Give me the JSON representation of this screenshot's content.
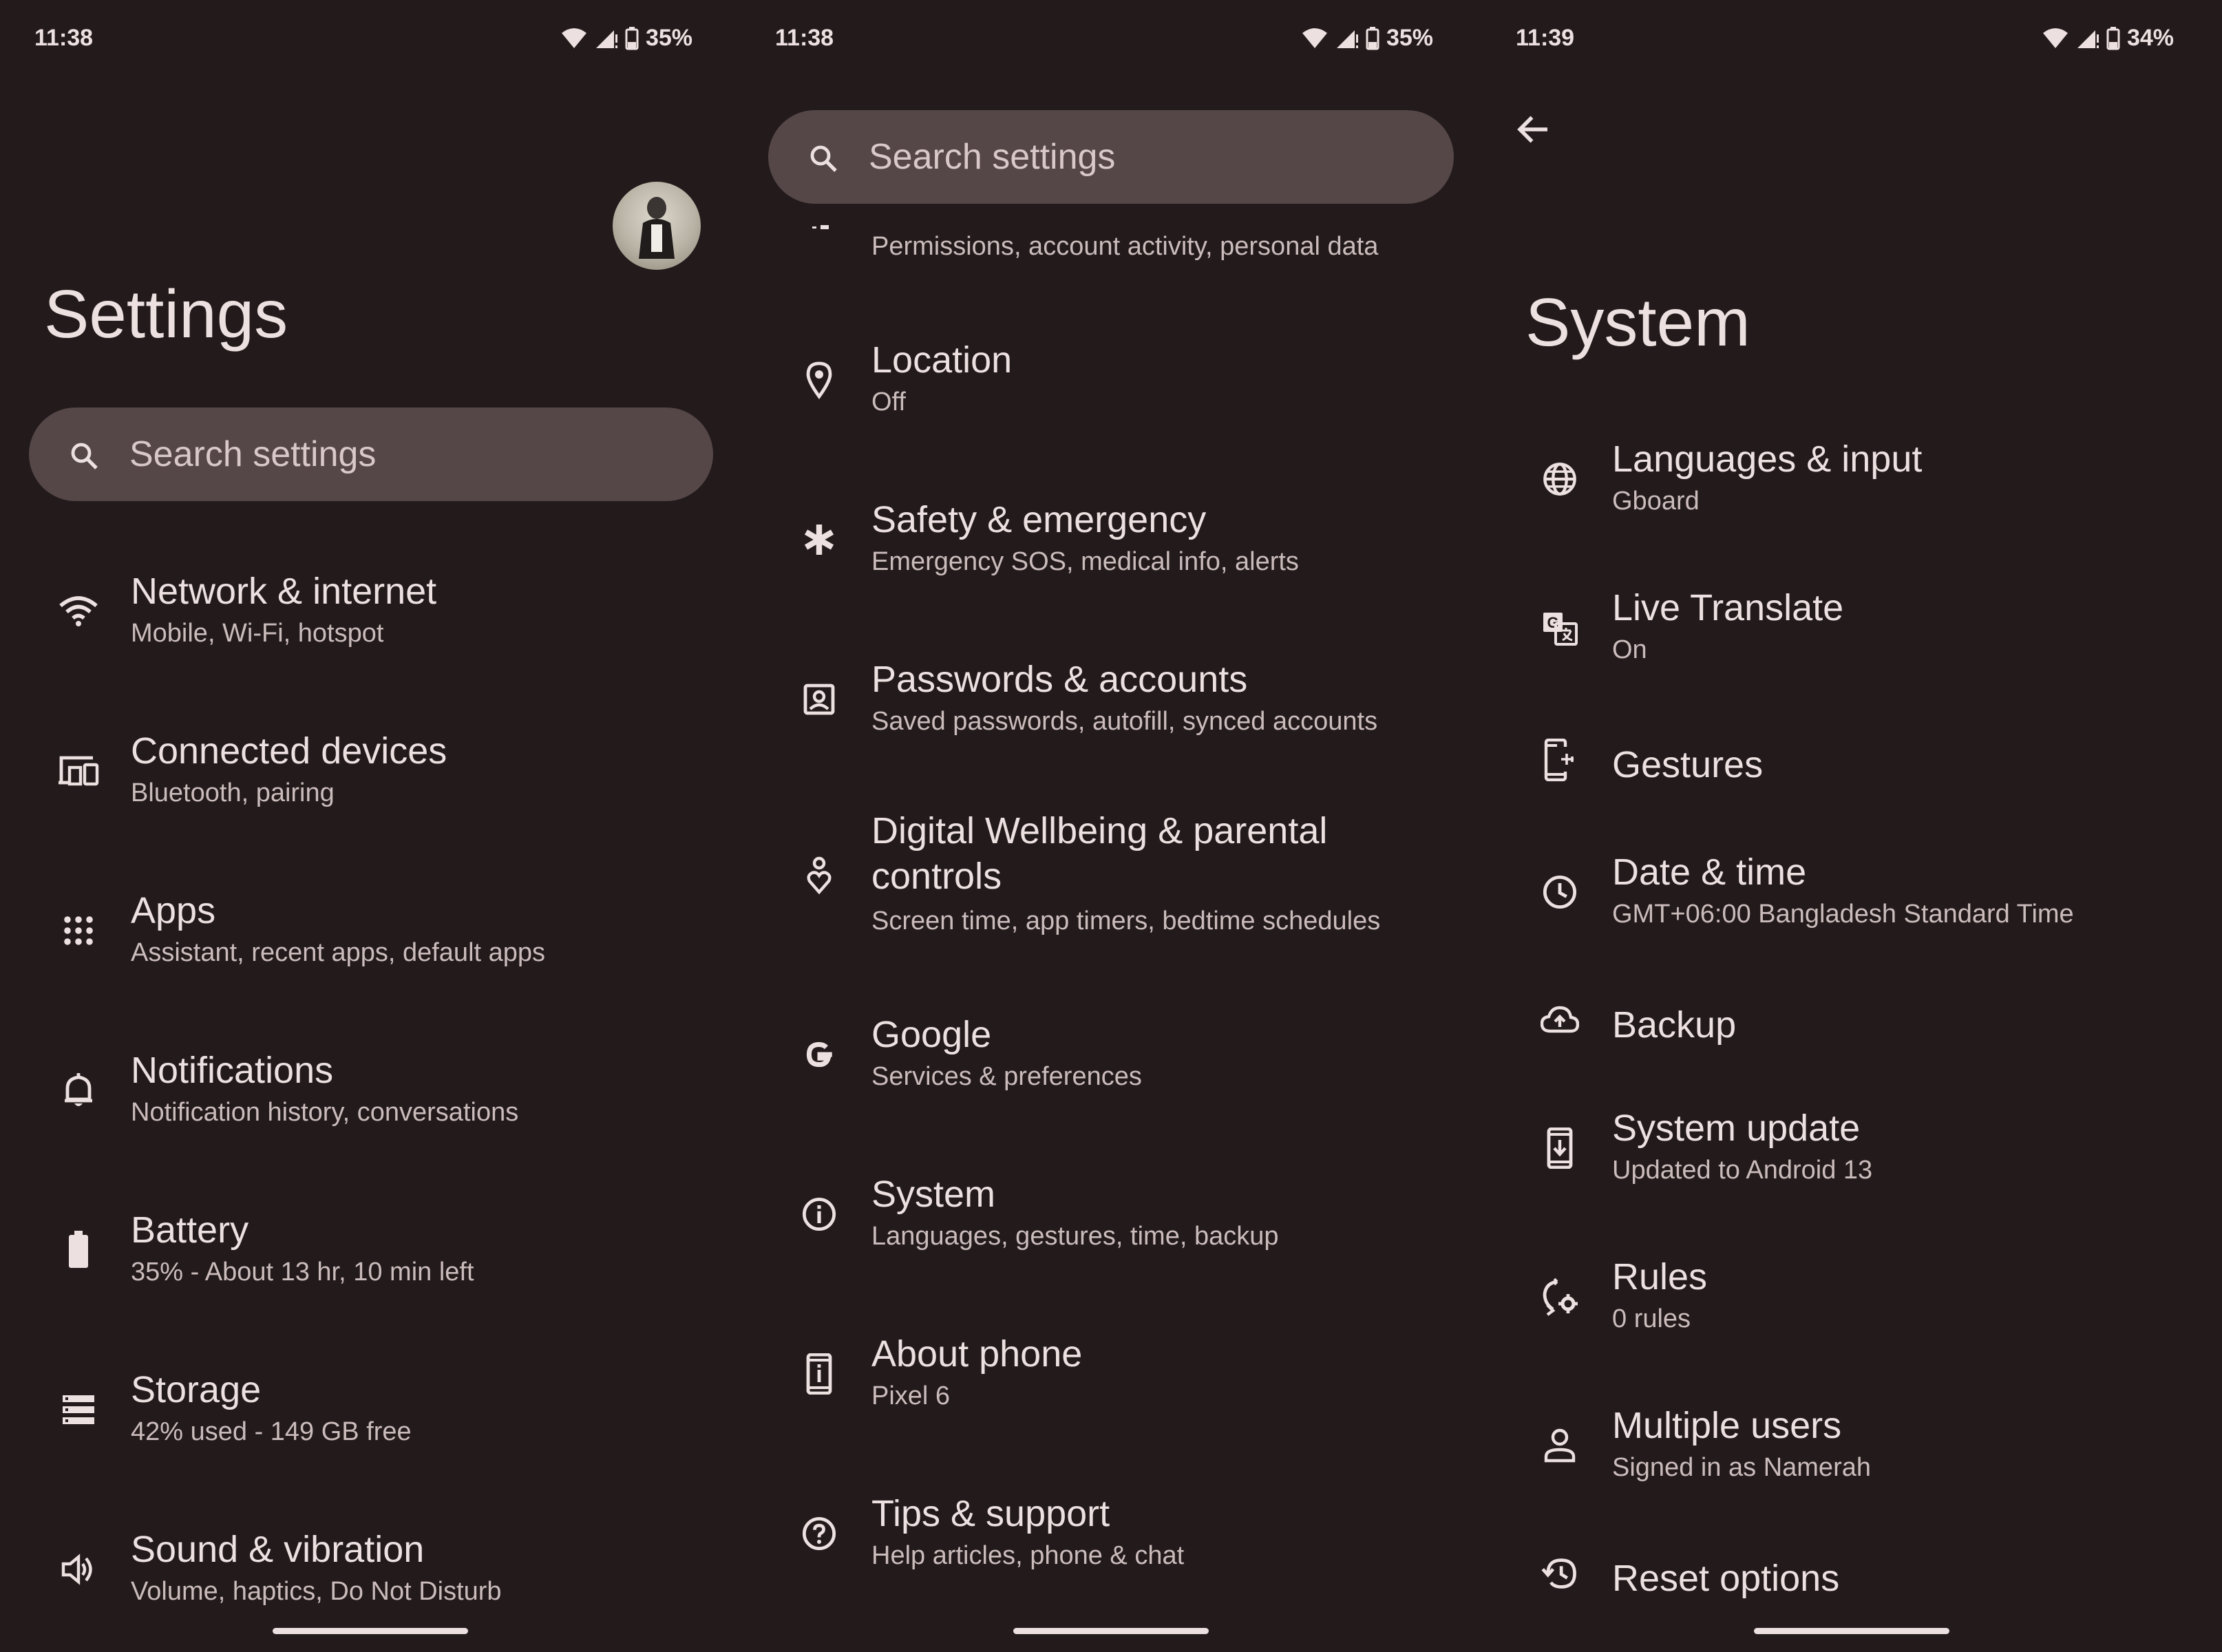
{
  "panel1": {
    "time": "11:38",
    "battery": "35%",
    "title": "Settings",
    "search_placeholder": "Search settings",
    "items": [
      {
        "title": "Network & internet",
        "subtitle": "Mobile, Wi-Fi, hotspot",
        "icon": "wifi-icon"
      },
      {
        "title": "Connected devices",
        "subtitle": "Bluetooth, pairing",
        "icon": "devices-icon"
      },
      {
        "title": "Apps",
        "subtitle": "Assistant, recent apps, default apps",
        "icon": "apps-grid-icon"
      },
      {
        "title": "Notifications",
        "subtitle": "Notification history, conversations",
        "icon": "bell-icon"
      },
      {
        "title": "Battery",
        "subtitle": "35% - About 13 hr, 10 min left",
        "icon": "battery-icon"
      },
      {
        "title": "Storage",
        "subtitle": "42% used - 149 GB free",
        "icon": "storage-icon"
      },
      {
        "title": "Sound & vibration",
        "subtitle": "Volume, haptics, Do Not Disturb",
        "icon": "speaker-icon"
      }
    ]
  },
  "panel2": {
    "time": "11:38",
    "battery": "35%",
    "search_placeholder": "Search settings",
    "partial_subtitle": "Permissions, account activity, personal data",
    "items": [
      {
        "title": "Location",
        "subtitle": "Off",
        "icon": "location-pin-icon"
      },
      {
        "title": "Safety & emergency",
        "subtitle": "Emergency SOS, medical info, alerts",
        "icon": "asterisk-icon"
      },
      {
        "title": "Passwords & accounts",
        "subtitle": "Saved passwords, autofill, synced accounts",
        "icon": "account-box-icon"
      },
      {
        "title_line1": "Digital Wellbeing & parental",
        "title_line2": "controls",
        "subtitle": "Screen time, app timers, bedtime schedules",
        "icon": "wellbeing-icon"
      },
      {
        "title": "Google",
        "subtitle": "Services & preferences",
        "icon": "google-g-icon"
      },
      {
        "title": "System",
        "subtitle": "Languages, gestures, time, backup",
        "icon": "info-icon"
      },
      {
        "title": "About phone",
        "subtitle": "Pixel 6",
        "icon": "phone-info-icon"
      },
      {
        "title": "Tips & support",
        "subtitle": "Help articles, phone & chat",
        "icon": "help-icon"
      }
    ]
  },
  "panel3": {
    "time": "11:39",
    "battery": "34%",
    "title": "System",
    "items": [
      {
        "title": "Languages & input",
        "subtitle": "Gboard",
        "icon": "globe-icon"
      },
      {
        "title": "Live Translate",
        "subtitle": "On",
        "icon": "translate-icon"
      },
      {
        "title": "Gestures",
        "subtitle": "",
        "icon": "gesture-phone-icon"
      },
      {
        "title": "Date & time",
        "subtitle": "GMT+06:00 Bangladesh Standard Time",
        "icon": "clock-icon"
      },
      {
        "title": "Backup",
        "subtitle": "",
        "icon": "cloud-upload-icon"
      },
      {
        "title": "System update",
        "subtitle": "Updated to Android 13",
        "icon": "system-update-icon"
      },
      {
        "title": "Rules",
        "subtitle": "0 rules",
        "icon": "rules-icon"
      },
      {
        "title": "Multiple users",
        "subtitle": "Signed in as Namerah",
        "icon": "person-icon"
      },
      {
        "title": "Reset options",
        "subtitle": "",
        "icon": "history-icon"
      }
    ]
  }
}
